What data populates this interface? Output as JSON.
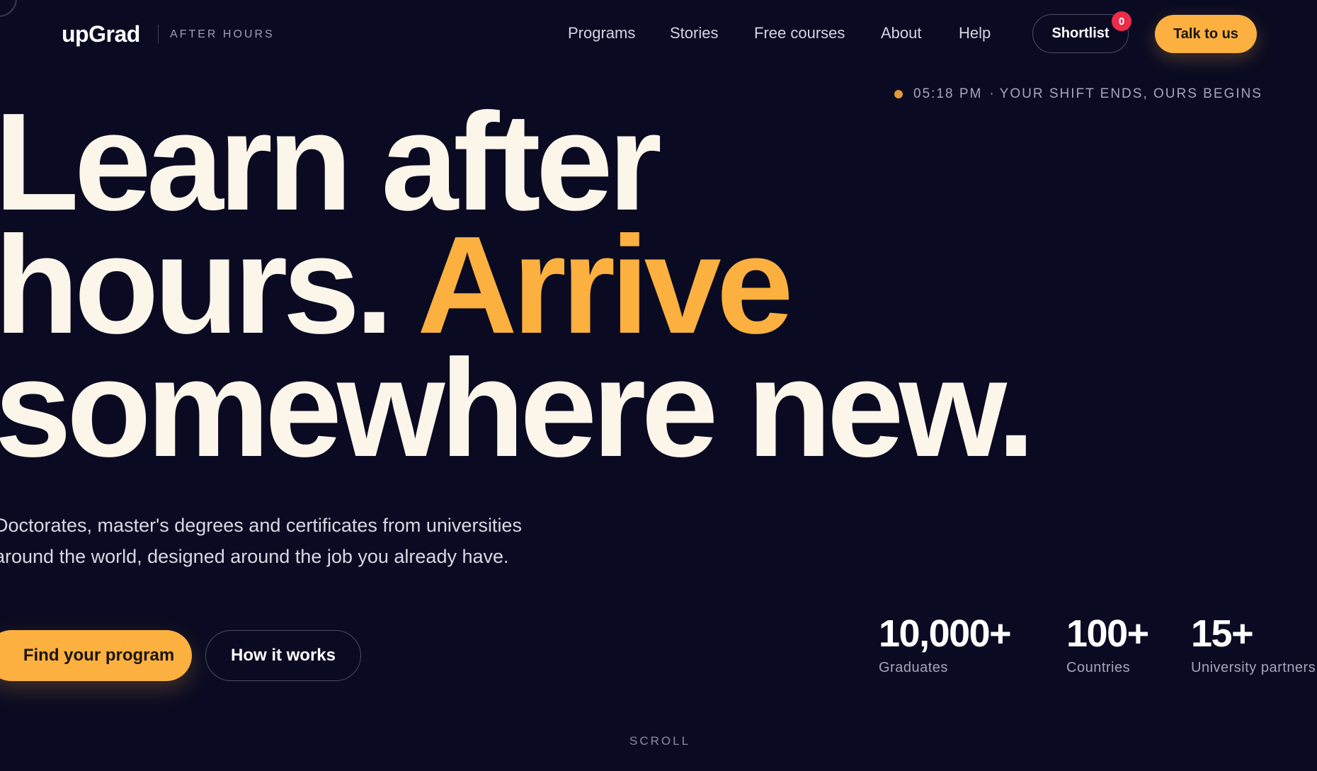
{
  "brand": {
    "logo": "upGrad",
    "tagline": "AFTER HOURS"
  },
  "nav": {
    "items": [
      "Programs",
      "Stories",
      "Free courses",
      "About",
      "Help"
    ],
    "shortlist_label": "Shortlist",
    "shortlist_count": "0",
    "cta_label": "Talk to us"
  },
  "status": {
    "time": "05:18 PM",
    "separator": "·",
    "message": "YOUR SHIFT ENDS, OURS BEGINS"
  },
  "hero": {
    "line1": "Learn after",
    "line2_start": "hours.",
    "line2_accent": "Arrive",
    "line3": "somewhere new.",
    "description": "Doctorates, master's degrees and certificates from universities around the world, designed around the job you already have.",
    "primary_cta": "Find your program",
    "secondary_cta": "How it works"
  },
  "stats": [
    {
      "value": "10,000+",
      "label": "Graduates"
    },
    {
      "value": "100+",
      "label": "Countries"
    },
    {
      "value": "15+",
      "label": "University partners"
    }
  ],
  "scroll_hint": "SCROLL",
  "colors": {
    "background": "#0a0b22",
    "accent": "#fbb040",
    "text": "#fbf5ea",
    "badge": "#ee2c4a"
  }
}
